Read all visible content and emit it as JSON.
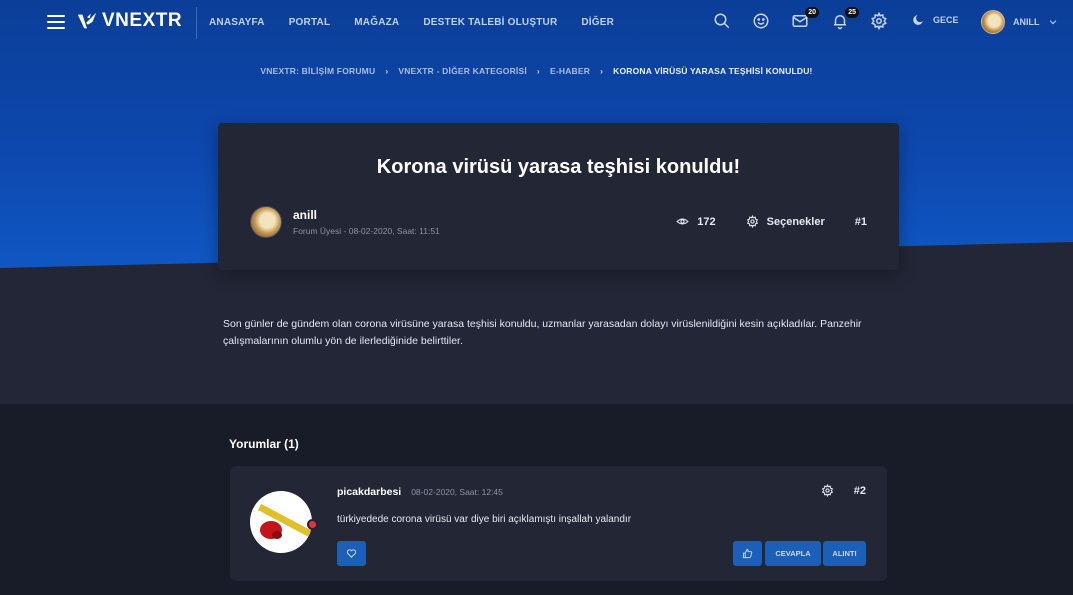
{
  "brand": {
    "name": "VNEXTR"
  },
  "nav": {
    "items": [
      "ANASAYFA",
      "PORTAL",
      "MAĞAZA",
      "DESTEK TALEBİ OLUŞTUR",
      "DİĞER"
    ],
    "messages_count": "20",
    "notifications_count": "25",
    "theme_label": "GECE",
    "user_name": "ANILL"
  },
  "breadcrumb": [
    "VNEXTR: BİLİŞİM FORUMU",
    "VNEXTR - DİĞER KATEGORİSİ",
    "E-HABER",
    "KORONA VİRÜSÜ YARASA TEŞHİSİ KONULDU!"
  ],
  "thread": {
    "title": "Korona virüsü yarasa teşhisi konuldu!",
    "author": "anill",
    "meta": "Forum Üyesi - 08-02-2020, Saat: 11:51",
    "views": "172",
    "options_label": "Seçenekler",
    "post_number": "#1",
    "body": "Son günler de gündem olan corona virüsüne yarasa teşhisi konuldu, uzmanlar yarasadan dolayı virüslenildiğini kesin açıkladılar. Panzehir çalışmalarının olumlu yön de ilerlediğinide belirttiler."
  },
  "comments": {
    "title": "Yorumlar (1)",
    "items": [
      {
        "author": "picakdarbesi",
        "date": "08-02-2020, Saat: 12:45",
        "post_number": "#2",
        "text": "türkiyedede corona virüsü var diye biri açıklamıştı inşallah yalandır",
        "reply_label": "CEVAPLA",
        "quote_label": "ALINTI"
      }
    ]
  },
  "colors": {
    "accent": "#1b5fb8",
    "hero": "#0d48ad",
    "card": "#232735",
    "online": "#e0343c"
  }
}
